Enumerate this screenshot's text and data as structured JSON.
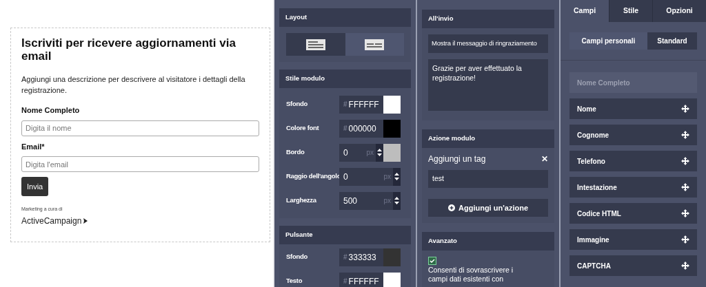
{
  "preview": {
    "title": "Iscriviti per ricevere aggiornamenti via email",
    "description": "Aggiungi una descrizione per descrivere al visitatore i dettagli della registrazione.",
    "fields": [
      {
        "label": "Nome Completo",
        "placeholder": "Digita il nome"
      },
      {
        "label": "Email*",
        "placeholder": "Digita l'email"
      }
    ],
    "submit": "Invia",
    "powered_by": "Marketing a cura di",
    "brand": "ActiveCampaign"
  },
  "layout": {
    "title": "Layout",
    "options": [
      {
        "selected": true
      },
      {
        "selected": false
      }
    ]
  },
  "form_style": {
    "title": "Stile modulo",
    "rows": [
      {
        "kind": "color",
        "label": "Sfondo",
        "hash": "#",
        "value": "FFFFFF"
      },
      {
        "kind": "color",
        "label": "Colore font",
        "hash": "#",
        "value": "000000"
      },
      {
        "kind": "number",
        "label": "Bordo",
        "value": "0",
        "unit": "px",
        "color": "#bdbdbd"
      },
      {
        "kind": "number",
        "label": "Raggio dell'angolo",
        "value": "0",
        "unit": "px"
      },
      {
        "kind": "number",
        "label": "Larghezza",
        "value": "500",
        "unit": "px"
      }
    ]
  },
  "button_style": {
    "title": "Pulsante",
    "rows": [
      {
        "kind": "color",
        "label": "Sfondo",
        "hash": "#",
        "value": "333333"
      },
      {
        "kind": "color",
        "label": "Testo",
        "hash": "#",
        "value": "FFFFFF"
      }
    ]
  },
  "on_submit": {
    "title": "All'invio",
    "select": "Mostra il messaggio di ringraziamento",
    "message": "Grazie per aver effettuato la registrazione!"
  },
  "form_action": {
    "title": "Azione modulo",
    "action_label": "Aggiungi un tag",
    "close": "✕",
    "tag": "test",
    "add_action": "Aggiungi un'azione"
  },
  "advanced": {
    "title": "Avanzato",
    "checked": true,
    "text": "Consenti di sovrascrivere i campi dati esistenti con"
  },
  "tabs": [
    {
      "label": "Campi",
      "selected": true
    },
    {
      "label": "Stile",
      "selected": false
    },
    {
      "label": "Opzioni",
      "selected": false
    }
  ],
  "segments": [
    {
      "label": "Campi personali",
      "selected": true
    },
    {
      "label": "Standard",
      "selected": false
    }
  ],
  "field_list": [
    {
      "label": "Nome Completo",
      "disabled": true
    },
    {
      "label": "Nome",
      "disabled": false
    },
    {
      "label": "Cognome",
      "disabled": false
    },
    {
      "label": "Telefono",
      "disabled": false
    },
    {
      "label": "Intestazione",
      "disabled": false
    },
    {
      "label": "Codice HTML",
      "disabled": false
    },
    {
      "label": "Immagine",
      "disabled": false
    },
    {
      "label": "CAPTCHA",
      "disabled": false
    }
  ]
}
